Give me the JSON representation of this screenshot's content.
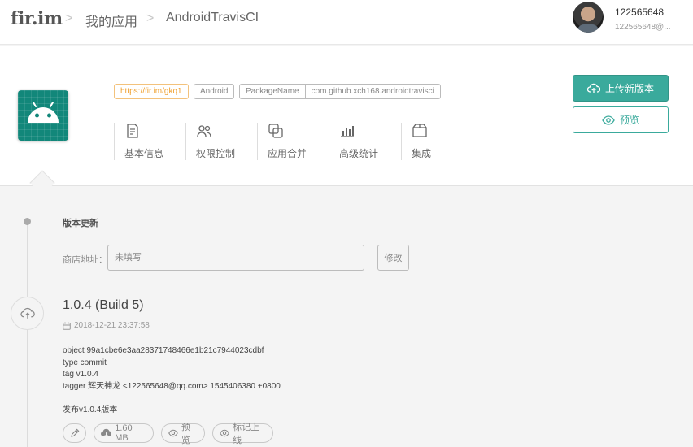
{
  "header": {
    "logo": "fir.im",
    "breadcrumbs": [
      "我的应用",
      "AndroidTravisCI"
    ],
    "user": {
      "name": "122565648",
      "email": "122565648@..."
    }
  },
  "app": {
    "icon": "android-app-icon",
    "short_link": "https://fir.im/gkq1",
    "platform": "Android",
    "package_label": "PackageName",
    "package_name": "com.github.xch168.androidtravisci",
    "menu": [
      {
        "label": "基本信息",
        "icon": "document-icon"
      },
      {
        "label": "权限控制",
        "icon": "users-icon"
      },
      {
        "label": "应用合并",
        "icon": "merge-icon"
      },
      {
        "label": "高级统计",
        "icon": "bar-chart-icon"
      },
      {
        "label": "集成",
        "icon": "box-icon"
      }
    ],
    "upload_label": "上传新版本",
    "preview_label": "预览",
    "accent_color": "#3aaa9c"
  },
  "updates": {
    "title": "版本更新",
    "store_label": "商店地址：",
    "store_placeholder": "未填写",
    "modify_label": "修改"
  },
  "release": {
    "version": "1.0.4 (Build 5)",
    "datetime": "2018-12-21 23:37:58",
    "notes": [
      "object 99a1cbe6e3aa28371748466e1b21c7944023cdbf",
      "type commit",
      "tag v1.0.4",
      "tagger 辉天神龙 <122565648@qq.com> 1545406380 +0800"
    ],
    "release_title": "发布v1.0.4版本",
    "size": "1.60 MB",
    "preview_label": "预览",
    "mark_online_label": "标记上线"
  }
}
